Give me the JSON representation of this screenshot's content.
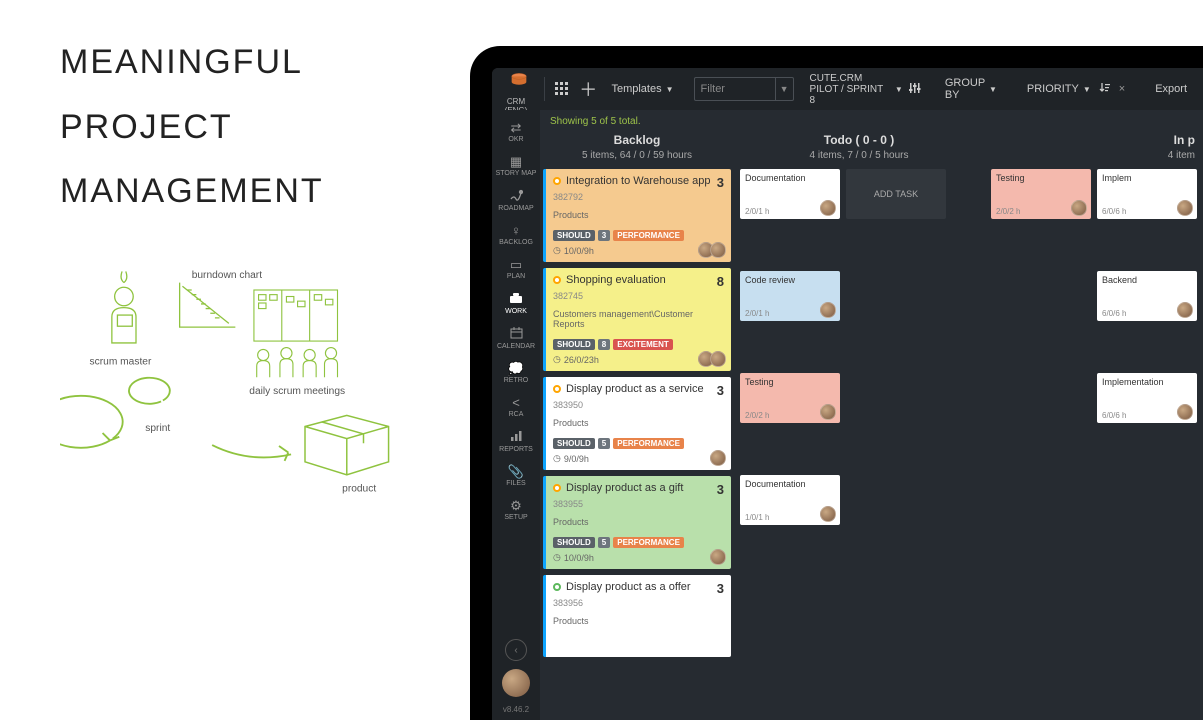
{
  "marketing": {
    "line1": "MEANINGFUL",
    "line2": "PROJECT",
    "line3": "MANAGEMENT",
    "annot_burndown": "burndown chart",
    "annot_scrum_master": "scrum master",
    "annot_daily": "daily scrum meetings",
    "annot_sprint": "sprint",
    "annot_product": "product"
  },
  "topbar": {
    "project": "CRM (ENG)",
    "templates": "Templates",
    "filter_placeholder": "Filter",
    "breadcrumb": "CUTE.CRM PILOT / SPRINT 8",
    "groupby": "GROUP BY",
    "priority": "PRIORITY",
    "export": "Export"
  },
  "sidebar": {
    "items": [
      {
        "label": "OKR"
      },
      {
        "label": "STORY MAP"
      },
      {
        "label": "ROADMAP"
      },
      {
        "label": "BACKLOG"
      },
      {
        "label": "PLAN"
      },
      {
        "label": "WORK"
      },
      {
        "label": "CALENDAR"
      },
      {
        "label": "RETRO"
      },
      {
        "label": "RCA"
      },
      {
        "label": "REPORTS"
      },
      {
        "label": "FILES"
      },
      {
        "label": "SETUP"
      }
    ],
    "version": "v8.46.2"
  },
  "board": {
    "status": "Showing 5 of 5 total.",
    "columns": {
      "backlog": {
        "title": "Backlog",
        "sub": "5 items, 64 / 0 / 59 hours"
      },
      "todo": {
        "title": "Todo  ( 0 - 0 )",
        "sub": "4 items, 7 / 0 / 5 hours"
      },
      "inprogress": {
        "title": "In p",
        "sub": "4 item"
      }
    },
    "rows": [
      {
        "backlog": {
          "title": "Integration to Warehouse app",
          "id": "382792",
          "pts": "3",
          "cat": "Products",
          "chips": [
            "SHOULD",
            "3",
            "PERFORMANCE"
          ],
          "hours": "10/0/9h",
          "color": "orange",
          "avatars": 2
        },
        "todo": [
          {
            "title": "Documentation",
            "meta": "2/0/1 h",
            "kind": "white"
          },
          {
            "kind": "add",
            "label": "ADD TASK"
          }
        ],
        "inprogress": [
          {
            "title": "Testing",
            "meta": "2/0/2 h",
            "kind": "pink"
          },
          {
            "title": "Implem",
            "meta": "6/0/6 h",
            "kind": "white"
          }
        ]
      },
      {
        "backlog": {
          "title": "Shopping evaluation",
          "id": "382745",
          "pts": "8",
          "cat": "Customers management\\Customer Reports",
          "chips": [
            "SHOULD",
            "8",
            "EXCITEMENT"
          ],
          "hours": "26/0/23h",
          "color": "yellow",
          "avatars": 2
        },
        "todo": [
          {
            "title": "Code review",
            "meta": "2/0/1 h",
            "kind": "blue"
          }
        ],
        "inprogress": [
          {
            "title": "Backend",
            "meta": "6/0/6 h",
            "kind": "white"
          }
        ]
      },
      {
        "backlog": {
          "title": "Display product as a service",
          "id": "383950",
          "pts": "3",
          "cat": "Products",
          "chips": [
            "SHOULD",
            "5",
            "PERFORMANCE"
          ],
          "hours": "9/0/9h",
          "color": "white",
          "avatars": 1
        },
        "todo": [
          {
            "title": "Testing",
            "meta": "2/0/2 h",
            "kind": "pink"
          }
        ],
        "inprogress": [
          {
            "title": "Implementation",
            "meta": "6/0/6 h",
            "kind": "white"
          }
        ]
      },
      {
        "backlog": {
          "title": "Display product as a gift",
          "id": "383955",
          "pts": "3",
          "cat": "Products",
          "chips": [
            "SHOULD",
            "5",
            "PERFORMANCE"
          ],
          "hours": "10/0/9h",
          "color": "green",
          "avatars": 1
        },
        "todo": [
          {
            "title": "Documentation",
            "meta": "1/0/1 h",
            "kind": "white"
          }
        ],
        "inprogress": []
      },
      {
        "backlog": {
          "title": "Display product as a offer",
          "id": "383956",
          "pts": "3",
          "cat": "Products",
          "chips": [],
          "hours": "",
          "color": "white",
          "avatars": 0,
          "dot": "green"
        },
        "todo": [],
        "inprogress": []
      }
    ]
  }
}
